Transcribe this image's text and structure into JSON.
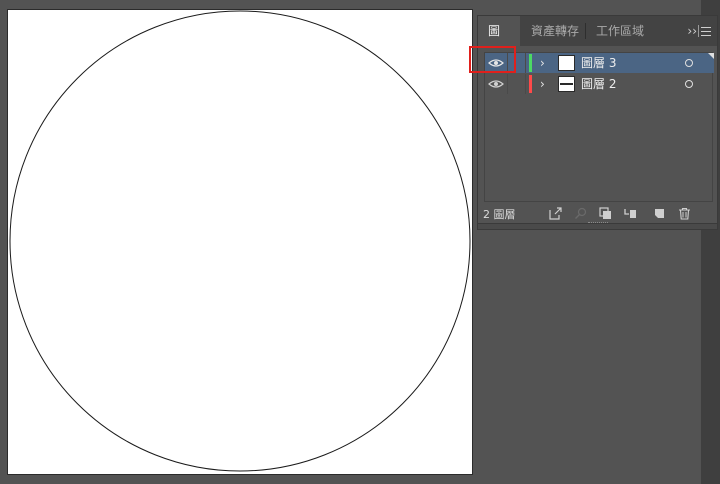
{
  "layers_panel": {
    "tabs": [
      {
        "label": "圖層",
        "active": true
      },
      {
        "label": "資產轉存",
        "active": false
      },
      {
        "label": "工作區域",
        "active": false
      }
    ],
    "more_label": "››",
    "layers": [
      {
        "name": "圖層 3",
        "color": "#4cd964",
        "selected": true,
        "visible": true
      },
      {
        "name": "圖層 2",
        "color": "#ff4a4a",
        "selected": false,
        "visible": true
      }
    ],
    "footer": {
      "count_label": "2 圖層"
    }
  },
  "colors": {
    "accent_selected": "#4b6584",
    "highlight_box": "#e0201c"
  },
  "icons": {
    "eye": "eye-icon",
    "chevron": "chevron-right-icon",
    "export": "export-icon",
    "locate": "search-icon",
    "clipping": "clipping-mask-icon",
    "new_sublayer": "new-sublayer-icon",
    "new_layer": "new-layer-icon",
    "trash": "trash-icon",
    "menu": "panel-menu-icon"
  }
}
